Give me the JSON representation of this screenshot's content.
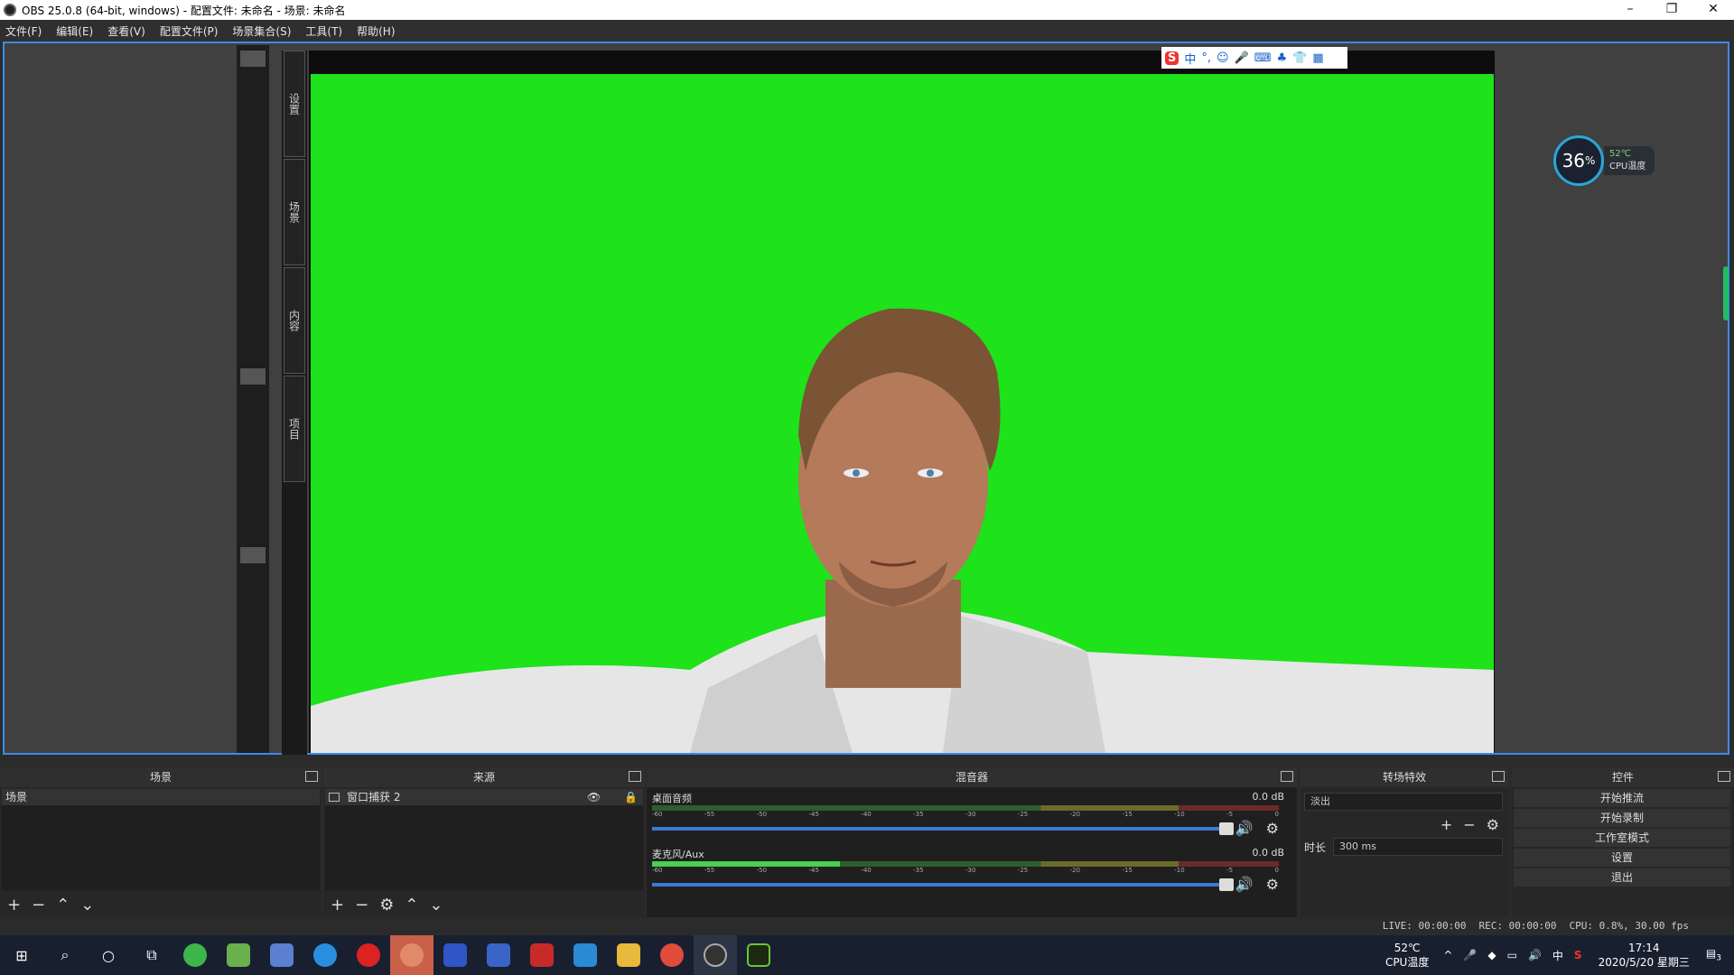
{
  "window": {
    "title": "OBS 25.0.8 (64-bit, windows) - 配置文件: 未命名 - 场景: 未命名",
    "minimize": "–",
    "maximize": "❐",
    "close": "✕"
  },
  "menu": [
    "文件(F)",
    "编辑(E)",
    "查看(V)",
    "配置文件(P)",
    "场景集合(S)",
    "工具(T)",
    "帮助(H)"
  ],
  "side_tabs": [
    "设置",
    "场景",
    "内容",
    "项目"
  ],
  "ime": {
    "logo": "S",
    "items": [
      "中",
      "°,",
      "☺",
      "🎤",
      "⌨",
      "♣",
      "👕",
      "▦"
    ]
  },
  "cpu_widget": {
    "value": "36",
    "unit": "%",
    "temp": "52℃",
    "label": "CPU温度"
  },
  "docks": {
    "scenes": {
      "title": "场景",
      "items": [
        "场景"
      ]
    },
    "sources": {
      "title": "来源",
      "items": [
        "窗口捕获 2"
      ]
    },
    "mixer": {
      "title": "混音器",
      "channels": [
        {
          "name": "桌面音频",
          "db": "0.0 dB",
          "level": 0.0
        },
        {
          "name": "麦克风/Aux",
          "db": "0.0 dB",
          "level": 0.3
        }
      ],
      "ticks": [
        "-60",
        "-55",
        "-50",
        "-45",
        "-40",
        "-35",
        "-30",
        "-25",
        "-20",
        "-15",
        "-10",
        "-5",
        "0"
      ]
    },
    "transitions": {
      "title": "转场特效",
      "type": "淡出",
      "duration_label": "时长",
      "duration": "300 ms"
    },
    "controls": {
      "title": "控件",
      "buttons": [
        "开始推流",
        "开始录制",
        "工作室模式",
        "设置",
        "退出"
      ]
    }
  },
  "status": {
    "live": "LIVE: 00:00:00",
    "rec": "REC: 00:00:00",
    "cpu": "CPU: 0.8%, 30.00 fps"
  },
  "taskbar": {
    "temp": "52℃",
    "temp_label": "CPU温度",
    "tray_lang": "中",
    "time": "17:14",
    "date": "2020/5/20 星期三",
    "notif_count": "3"
  }
}
